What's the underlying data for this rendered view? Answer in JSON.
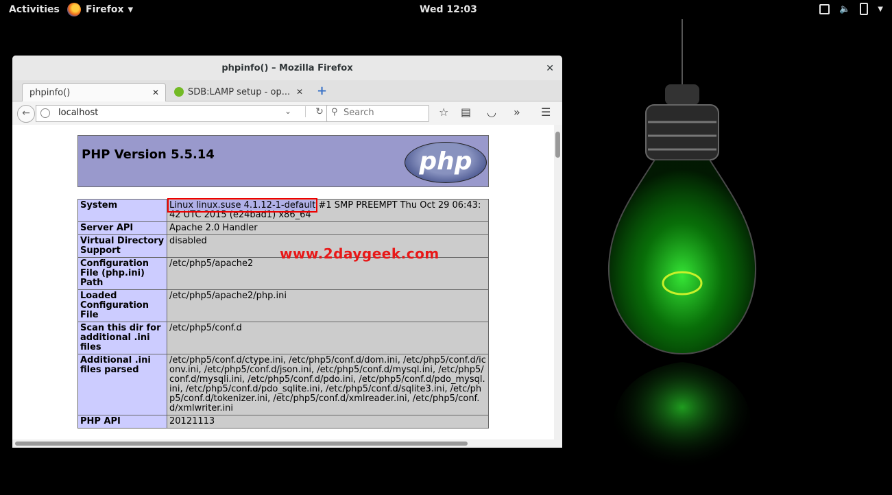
{
  "topbar": {
    "activities": "Activities",
    "app_menu": "Firefox",
    "clock": "Wed 12:03"
  },
  "window": {
    "title": "phpinfo() – Mozilla Firefox"
  },
  "tabs": [
    {
      "label": "phpinfo()"
    },
    {
      "label": "SDB:LAMP setup - op..."
    }
  ],
  "navbar": {
    "url": "localhost",
    "search_placeholder": "Search"
  },
  "php": {
    "version_title": "PHP Version 5.5.14",
    "logo_text": "php",
    "rows": [
      {
        "key": "System",
        "value_highlight": "Linux linux.suse 4.1.12-1-default",
        "value_rest": " #1 SMP PREEMPT Thu Oct 29 06:43:42 UTC 2015 (e24bad1) x86_64"
      },
      {
        "key": "Server API",
        "value": "Apache 2.0 Handler"
      },
      {
        "key": "Virtual Directory Support",
        "value": "disabled"
      },
      {
        "key": "Configuration File (php.ini) Path",
        "value": "/etc/php5/apache2"
      },
      {
        "key": "Loaded Configuration File",
        "value": "/etc/php5/apache2/php.ini"
      },
      {
        "key": "Scan this dir for additional .ini files",
        "value": "/etc/php5/conf.d"
      },
      {
        "key": "Additional .ini files parsed",
        "value": "/etc/php5/conf.d/ctype.ini, /etc/php5/conf.d/dom.ini, /etc/php5/conf.d/iconv.ini, /etc/php5/conf.d/json.ini, /etc/php5/conf.d/mysql.ini, /etc/php5/conf.d/mysqli.ini, /etc/php5/conf.d/pdo.ini, /etc/php5/conf.d/pdo_mysql.ini, /etc/php5/conf.d/pdo_sqlite.ini, /etc/php5/conf.d/sqlite3.ini, /etc/php5/conf.d/tokenizer.ini, /etc/php5/conf.d/xmlreader.ini, /etc/php5/conf.d/xmlwriter.ini"
      },
      {
        "key": "PHP API",
        "value": "20121113"
      }
    ]
  },
  "watermark": "www.2daygeek.com",
  "colors": {
    "php_header": "#9999cc",
    "php_key": "#ccccff",
    "php_value": "#cccccc",
    "highlight_box": "#e00000",
    "watermark": "#e81818"
  }
}
